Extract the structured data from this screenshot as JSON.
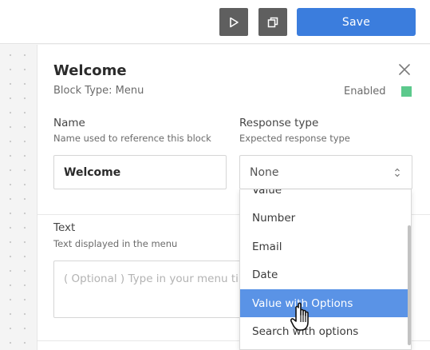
{
  "toolbar": {
    "play_icon": "play-icon",
    "copy_icon": "copy-icon",
    "save_label": "Save",
    "accent": "#3b7ddd"
  },
  "panel": {
    "title": "Welcome",
    "block_type": "Block Type: Menu",
    "enabled_label": "Enabled",
    "enabled_color": "#5cc98c",
    "name": {
      "label": "Name",
      "help": "Name used to reference this block",
      "value": "Welcome"
    },
    "response": {
      "label": "Response type",
      "help": "Expected response type",
      "value": "None"
    },
    "text": {
      "label": "Text",
      "help": "Text displayed in the menu",
      "placeholder": "( Optional ) Type in your menu ti"
    }
  },
  "dropdown": {
    "options": [
      "Value",
      "Number",
      "Email",
      "Date",
      "Value with Options",
      "Search with options"
    ],
    "selected": "Value with Options",
    "selected_color": "#5a93e6"
  }
}
